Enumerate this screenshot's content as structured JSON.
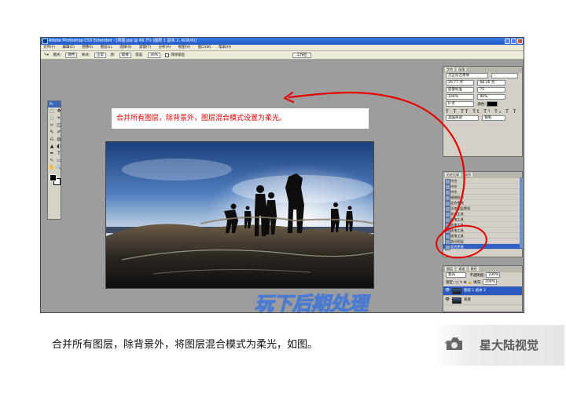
{
  "window": {
    "title": "Adobe Photoshop CS3 Extended - [原图.jpg @ 66.7% (图层 1 副本 2, RGB/8)]"
  },
  "menu": [
    "文件(F)",
    "编辑(E)",
    "图像(I)",
    "图层(L)",
    "选择(S)",
    "滤镜(T)",
    "分析(A)",
    "视图(V)",
    "窗口(W)",
    "帮助(H)"
  ],
  "options_bar": {
    "mode_label": "模式:",
    "mode_value": "颜色",
    "style_label": "样式:",
    "style_value": "正常",
    "source_label": "源:",
    "source_value": "取样",
    "opacity_label": "不透明度:",
    "opacity_value": "100%",
    "tolerance_label": "容差:",
    "tolerance_value": "30%",
    "antialias_label": "消除锯齿",
    "workspace_label": "工作区"
  },
  "toolbox": {
    "badge": "Ps",
    "tools": [
      "⬚",
      "✥",
      "◌",
      "⌖",
      "✂",
      "◫",
      "✎",
      "✐",
      "⎌",
      "◍",
      "▲",
      "◐",
      "✒",
      "T",
      "↖",
      "▭",
      "✋",
      "🔍"
    ]
  },
  "annotation": {
    "text": "合并所有图层，除背景外，图层混合模式设置为柔光。",
    "color": "#e60000"
  },
  "watermark": {
    "text": "玩下后期处理"
  },
  "character_panel": {
    "tabs": [
      "字符",
      "段落"
    ],
    "font_family": "方正综艺简体",
    "font_style": "-",
    "font_size": "20.77 点",
    "leading": "68.26 点",
    "kerning": "度量标准",
    "tracking": "75",
    "vertical_scale": "100%",
    "horizontal_scale": "90%",
    "baseline": "0 点",
    "color_label": "颜色:",
    "language": "美国英语",
    "antialias": "锐利"
  },
  "history_panel": {
    "tabs": [
      "历史记录",
      "动作"
    ],
    "items": [
      "拼合",
      "拼合",
      "拼合",
      "模糊画布",
      "混合更改",
      "添加图层蒙版",
      "画笔工具",
      "画笔工具",
      "画笔工具",
      "画笔工具",
      "画笔工具",
      "盖印图层",
      "混合更改"
    ],
    "active_index": 12
  },
  "layers_panel": {
    "tabs": [
      "图层",
      "通道",
      "路径"
    ],
    "blend_mode": "柔光",
    "opacity_label": "不透明度:",
    "opacity_value": "100%",
    "lock_label": "锁定:",
    "fill_label": "填充:",
    "fill_value": "100%",
    "layers": [
      {
        "name": "图层 1 副本 2",
        "active": true
      },
      {
        "name": "背景",
        "active": false
      }
    ]
  },
  "caption": "合并所有图层，除背景外，将图层混合模式为柔光，如图。",
  "brand": {
    "name": "星大陆视觉"
  }
}
